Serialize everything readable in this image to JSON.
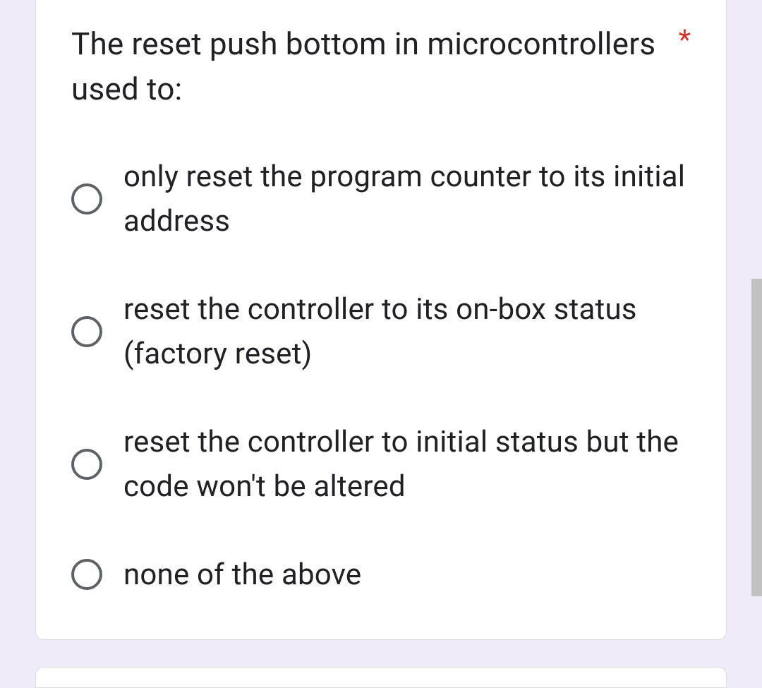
{
  "question": {
    "text": "The reset push bottom in microcontrollers used to:",
    "required_marker": "*",
    "options": [
      {
        "label": "only reset the program counter to its initial address"
      },
      {
        "label": "reset the controller to its on-box status (factory reset)"
      },
      {
        "label": "reset the controller to initial status but the code won't be altered"
      },
      {
        "label": "none of the above"
      }
    ]
  }
}
